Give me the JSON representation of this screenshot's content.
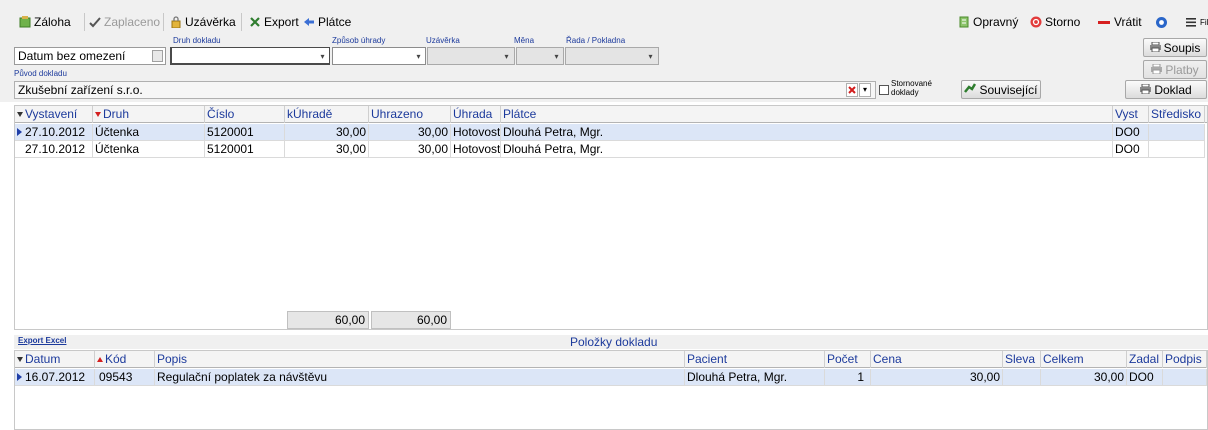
{
  "toolbar": {
    "zaloha": "Záloha",
    "zaplaceno": "Zaplaceno",
    "uzaverka": "Uzávěrka",
    "export": "Export",
    "platce": "Plátce",
    "opravny": "Opravný",
    "storno": "Storno",
    "vratit": "Vrátit",
    "filter": "Fil"
  },
  "filters": {
    "druh_dokladu_label": "Druh dokladu",
    "zpusob_uhrady_label": "Způsob úhrady",
    "uzaverka_label": "Uzávěrka",
    "mena_label": "Měna",
    "rada_label": "Řada / Pokladna",
    "date_range_value": "Datum bez omezení",
    "druh_dokladu_value": "",
    "zpusob_uhrady_value": "",
    "uzaverka_value": "",
    "mena_value": "",
    "rada_value": "",
    "puvod_label": "Původ dokladu",
    "puvod_value": "Zkušební zařízení s.r.o.",
    "stornovane_label_1": "Stornované",
    "stornovane_label_2": "doklady",
    "stornovane_checked": false,
    "souvisejici": "Související",
    "soupis": "Soupis",
    "platby": "Platby",
    "doklad": "Doklad"
  },
  "documents": {
    "columns": [
      "Vystavení",
      "Druh",
      "Číslo",
      "kÚhradě",
      "Uhrazeno",
      "Úhrada",
      "Plátce",
      "Vyst",
      "Středisko"
    ],
    "rows": [
      {
        "vystaveni": "27.10.2012",
        "druh": "Účtenka",
        "cislo": "5120001",
        "kuhrade": "30,00",
        "uhrazeno": "30,00",
        "uhrada": "Hotovost",
        "platce": "Dlouhá  Petra, Mgr.",
        "vyst": "DO0",
        "stredisko": ""
      },
      {
        "vystaveni": "27.10.2012",
        "druh": "Účtenka",
        "cislo": "5120001",
        "kuhrade": "30,00",
        "uhrazeno": "30,00",
        "uhrada": "Hotovost",
        "platce": "Dlouhá  Petra, Mgr.",
        "vyst": "DO0",
        "stredisko": ""
      }
    ],
    "sum_kuhrade": "60,00",
    "sum_uhrazeno": "60,00"
  },
  "items": {
    "export_excel": "Export Excel",
    "title": "Položky dokladu",
    "columns": [
      "Datum",
      "Kód",
      "Popis",
      "Pacient",
      "Počet",
      "Cena",
      "Sleva",
      "Celkem",
      "Zadal",
      "Podpis"
    ],
    "rows": [
      {
        "datum": "16.07.2012",
        "kod": "09543",
        "popis": "Regulační poplatek za návštěvu",
        "pacient": "Dlouhá  Petra, Mgr.",
        "pocet": "1",
        "cena": "30,00",
        "sleva": "",
        "celkem": "30,00",
        "zadal": "DO0",
        "podpis": ""
      }
    ]
  },
  "colors": {
    "selected_row": "#dce6f7",
    "header_text": "#1c3a9c",
    "toolbar_bg": "#f0f0f0"
  }
}
